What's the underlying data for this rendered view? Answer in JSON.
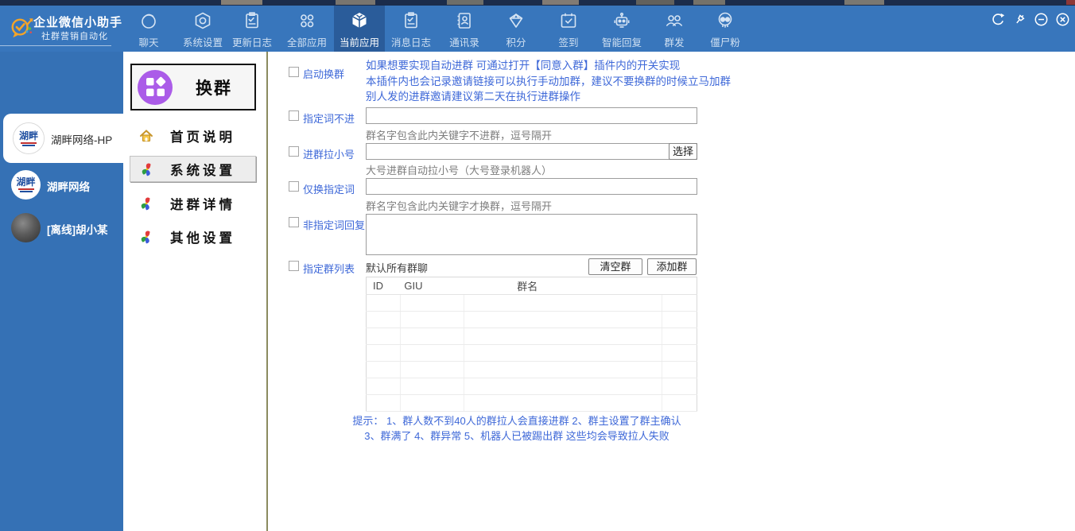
{
  "colors": {
    "topbar_blue": "#3876bc",
    "active_tab_blue": "#2a5c9a",
    "sidebar_blue": "#3571b5",
    "accent_blue_text": "#3e68d8",
    "plugin_purple": "#ab5ce8",
    "divider_olive": "#8b8b5f"
  },
  "titlebar": {
    "app_title": "企业微信小助手",
    "app_subtitle": "社群营销自动化"
  },
  "window_controls": {
    "refresh": "refresh",
    "pin": "pin",
    "minimize": "minimize",
    "close": "close"
  },
  "topnav": {
    "items": [
      {
        "label": "聊天",
        "icon": "chat-icon"
      },
      {
        "label": "系统设置",
        "icon": "hexagon-settings-icon"
      },
      {
        "label": "更新日志",
        "icon": "changelog-icon"
      },
      {
        "label": "全部应用",
        "icon": "all-apps-icon"
      },
      {
        "label": "当前应用",
        "icon": "current-app-cube-icon",
        "active": true
      },
      {
        "label": "消息日志",
        "icon": "message-log-icon"
      },
      {
        "label": "通讯录",
        "icon": "contacts-icon"
      },
      {
        "label": "积分",
        "icon": "points-diamond-icon"
      },
      {
        "label": "签到",
        "icon": "checkin-calendar-icon"
      },
      {
        "label": "智能回复",
        "icon": "smart-reply-robot-icon"
      },
      {
        "label": "群发",
        "icon": "broadcast-group-icon"
      },
      {
        "label": "僵尸粉",
        "icon": "zombie-fans-skull-icon"
      }
    ]
  },
  "accounts": [
    {
      "name": "湖畔网络-HP",
      "avatar_text": "湖畔",
      "selected": true
    },
    {
      "name": "湖畔网络",
      "avatar_text": "湖畔",
      "selected": false
    },
    {
      "name": "[离线]胡小某",
      "avatar_text": "",
      "selected": false
    }
  ],
  "plugin_panel": {
    "title": "换群",
    "menu": [
      {
        "label": "首页说明",
        "icon": "home-icon",
        "selected": false
      },
      {
        "label": "系统设置",
        "icon": "pinwheel-icon",
        "selected": true
      },
      {
        "label": "进群详情",
        "icon": "pinwheel-icon",
        "selected": false
      },
      {
        "label": "其他设置",
        "icon": "pinwheel-icon",
        "selected": false
      }
    ]
  },
  "main": {
    "auto_switch": {
      "label": "启动换群",
      "checked": false,
      "notes": [
        "如果想要实现自动进群 可通过打开【同意入群】插件内的开关实现",
        "本插件内也会记录邀请链接可以执行手动加群，建议不要换群的时候立马加群",
        "别人发的进群邀请建议第二天在执行进群操作"
      ]
    },
    "exclude_words": {
      "label": "指定词不进",
      "checked": false,
      "value": "",
      "hint": "群名字包含此内关键字不进群，逗号隔开"
    },
    "pull_alt_account": {
      "label": "进群拉小号",
      "checked": false,
      "value": "",
      "select_button": "选择",
      "hint": "大号进群自动拉小号（大号登录机器人）"
    },
    "only_words": {
      "label": "仅换指定词",
      "checked": false,
      "value": "",
      "hint": "群名字包含此内关键字才换群，逗号隔开"
    },
    "non_word_reply": {
      "label": "非指定词回复",
      "checked": false,
      "value": ""
    },
    "group_list": {
      "label": "指定群列表",
      "checked": false,
      "note": "默认所有群聊",
      "clear_button": "清空群",
      "add_button": "添加群"
    },
    "group_table": {
      "columns": [
        "ID",
        "GIU",
        "群名",
        ""
      ],
      "rows": [],
      "empty_row_count": 7
    },
    "tips": [
      "提示：  1、群人数不到40人的群拉人会直接进群 2、群主设置了群主确认",
      "3、群满了  4、群异常 5、机器人已被踢出群  这些均会导致拉人失败"
    ]
  }
}
